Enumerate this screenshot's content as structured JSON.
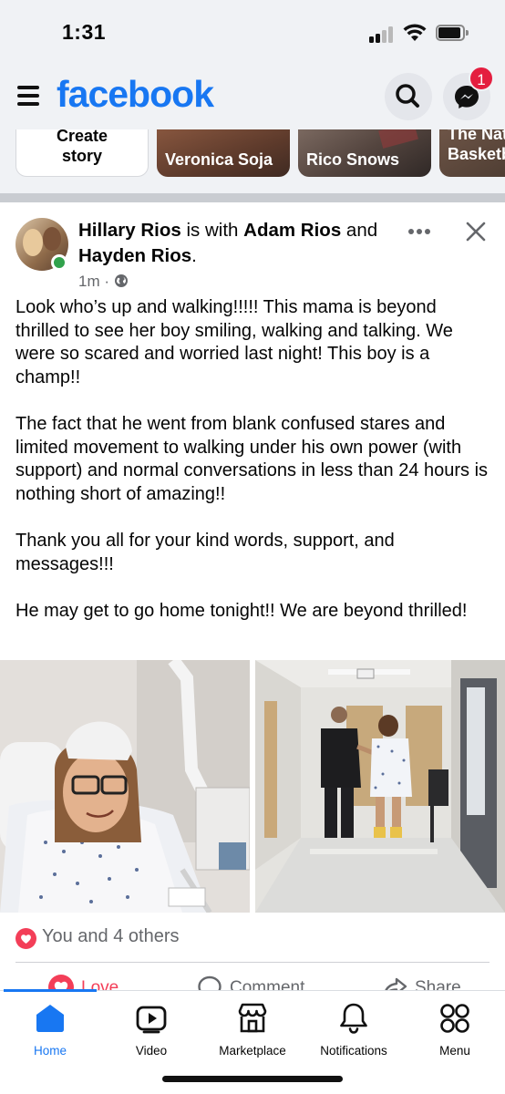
{
  "status_bar": {
    "time": "1:31"
  },
  "header": {
    "logo": "facebook",
    "messenger_badge": "1",
    "icons": [
      "menu-icon",
      "search-icon",
      "messenger-icon"
    ]
  },
  "stories": [
    {
      "line1": "Create",
      "line2": "story"
    },
    {
      "name": "Veronica Soja"
    },
    {
      "name": "Rico Snows"
    },
    {
      "line1": "The Nat",
      "line2": "Basketb"
    }
  ],
  "post": {
    "author": "Hillary Rios",
    "with_text": " is with ",
    "tagged_1": "Adam Rios",
    "and_text": " and ",
    "tagged_2": "Hayden Rios",
    "period": ".",
    "time": "1m",
    "separator": " · ",
    "audience_icon": "globe-icon",
    "paragraphs": [
      "Look who’s up and walking!!!!! This mama is beyond thrilled to see her boy smiling, walking and talking. We were so scared and worried last night! This boy is a champ!!",
      "The fact that he went from blank confused stares and limited movement to walking under his own power (with support) and normal conversations in less than 24 hours is nothing short of amazing!!",
      "Thank you all for your kind words, support, and messages!!!",
      "He may get to go home tonight!! We are beyond thrilled!"
    ],
    "reactions_text": "You and 4 others",
    "actions": {
      "love": "Love",
      "comment": "Comment",
      "share": "Share"
    }
  },
  "bottom_nav": [
    {
      "label": "Home",
      "icon": "home-icon",
      "active": true
    },
    {
      "label": "Video",
      "icon": "video-icon"
    },
    {
      "label": "Marketplace",
      "icon": "marketplace-icon"
    },
    {
      "label": "Notifications",
      "icon": "bell-icon"
    },
    {
      "label": "Menu",
      "icon": "grid-menu-icon"
    }
  ],
  "colors": {
    "brand": "#1877f2",
    "love": "#f33e58",
    "badge": "#e41e3f",
    "online": "#31a24c"
  }
}
